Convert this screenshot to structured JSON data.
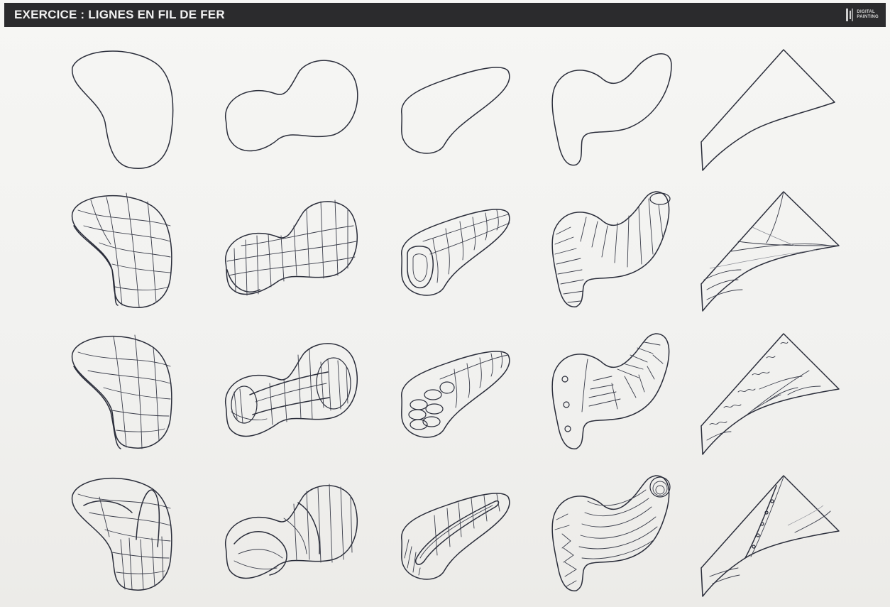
{
  "header": {
    "title": "EXERCICE : LIGNES EN FIL DE FER",
    "brand_line1": "DIGITAL",
    "brand_line2": "PAINTING"
  },
  "colors": {
    "header_bg": "#2b2b2d",
    "ink": "#2a2d3a",
    "paper": "#f3f3f1"
  }
}
